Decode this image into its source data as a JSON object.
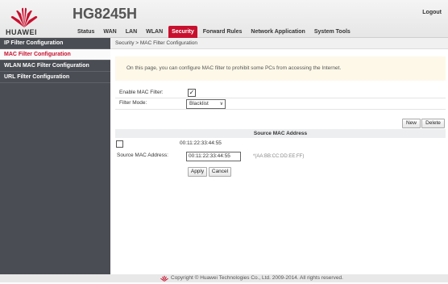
{
  "header": {
    "brand": "HUAWEI",
    "model": "HG8245H",
    "logout_label": "Logout",
    "nav": [
      "Status",
      "WAN",
      "LAN",
      "WLAN",
      "Security",
      "Forward Rules",
      "Network Application",
      "System Tools"
    ],
    "active_nav": "Security"
  },
  "sidebar": {
    "items": [
      {
        "label": "IP Filter Configuration"
      },
      {
        "label": "MAC Filter Configuration"
      },
      {
        "label": "WLAN MAC Filter Configuration"
      },
      {
        "label": "URL Filter Configuration"
      }
    ],
    "active": "MAC Filter Configuration"
  },
  "breadcrumb": "Security > MAC Filter Configuration",
  "notice": "On this page, you can configure MAC filter to prohibit some PCs from accessing the Internet.",
  "form": {
    "enable_label": "Enable MAC Filter:",
    "enable_checked": "✓",
    "mode_label": "Filter Mode:",
    "mode_value": "Blacklist",
    "mode_arrow": "∨"
  },
  "table": {
    "new_label": "New",
    "delete_label": "Delete",
    "column_header": "Source MAC Address",
    "rows": [
      {
        "mac": "00:11:22:33:44:55"
      }
    ]
  },
  "edit": {
    "label": "Source MAC Address:",
    "value": "00:11:22:33:44:55",
    "hint": "*(AA:BB:CC:DD:EE:FF)",
    "apply_label": "Apply",
    "cancel_label": "Cancel"
  },
  "footer": {
    "copyright": "Copyright © Huawei Technologies Co., Ltd. 2009-2014. All rights reserved."
  },
  "colors": {
    "accent": "#c8102e",
    "sidebar_bg": "#4a4d53",
    "notice_bg": "#fdf8e8"
  }
}
